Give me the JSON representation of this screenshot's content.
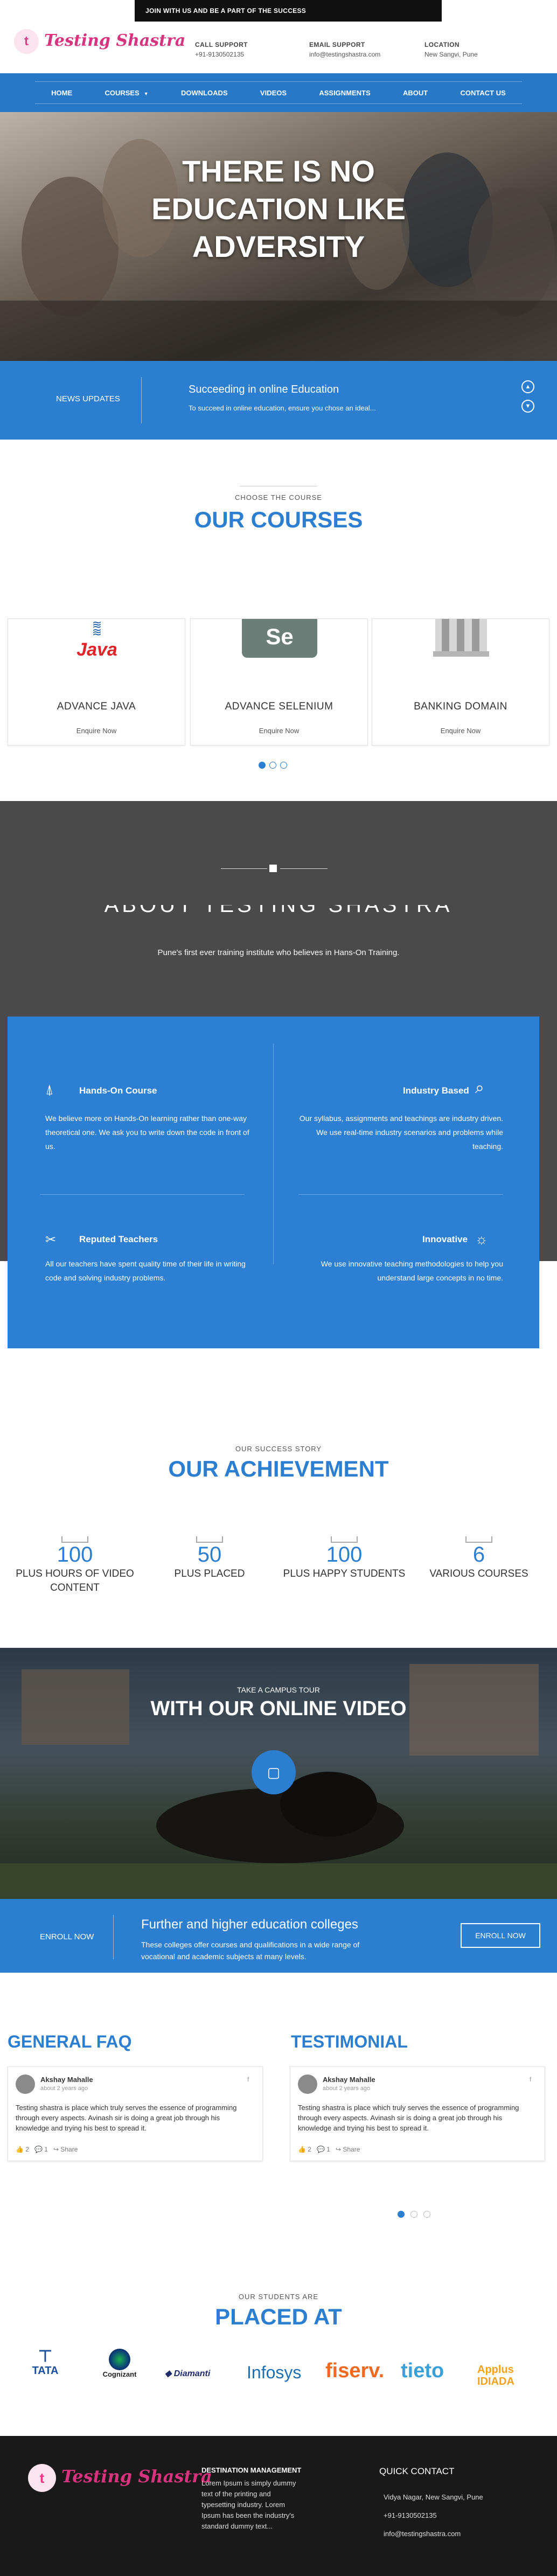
{
  "topbar": {
    "text": "JOIN WITH US AND BE A PART OF THE SUCCESS"
  },
  "header": {
    "logo_text": "Testing Shastra",
    "support": {
      "label": "CALL SUPPORT",
      "value": "+91-9130502135"
    },
    "email": {
      "label": "EMAIL SUPPORT",
      "value": "info@testingshastra.com"
    },
    "location": {
      "label": "LOCATION",
      "value": "New Sangvi, Pune"
    }
  },
  "nav": [
    "HOME",
    "COURSES",
    "DOWNLOADS",
    "VIDEOS",
    "ASSIGNMENTS",
    "ABOUT",
    "CONTACT US"
  ],
  "hero": {
    "line1": "THERE IS NO",
    "line2": "EDUCATION LIKE",
    "line3": "ADVERSITY"
  },
  "news": {
    "label": "NEWS UPDATES",
    "title": "Succeeding in online Education",
    "text": "To succeed in online education, ensure you chose an ideal..."
  },
  "courses": {
    "sub": "CHOOSE THE COURSE",
    "title": "OUR COURSES",
    "items": [
      {
        "name": "ADVANCE JAVA",
        "button": "Enquire Now",
        "logo": "Java"
      },
      {
        "name": "ADVANCE SELENIUM",
        "button": "Enquire Now",
        "logo": "Se"
      },
      {
        "name": "BANKING DOMAIN",
        "button": "Enquire Now",
        "logo": "bank-icon"
      }
    ]
  },
  "about": {
    "title": "ABOUT TESTING SHASTRA",
    "subtitle": "Pune's first ever training institute who believes in Hans-On Training.",
    "features": [
      {
        "title": "Hands-On Course",
        "text": "We believe more on Hands-On learning rather than one-way theoretical one. We ask you to write down the code in front of us."
      },
      {
        "title": "Industry Based",
        "text": "Our syllabus, assignments and teachings are industry driven. We use real-time industry scenarios and problems while teaching."
      },
      {
        "title": "Reputed Teachers",
        "text": "All our teachers have spent quality time of their life in writing code and solving industry problems."
      },
      {
        "title": "Innovative",
        "text": "We use innovative teaching methodologies to help you understand large concepts in no time."
      }
    ]
  },
  "achievement": {
    "sub": "OUR SUCCESS STORY",
    "title": "OUR ACHIEVEMENT",
    "items": [
      {
        "num": "100",
        "label": "PLUS HOURS OF VIDEO CONTENT"
      },
      {
        "num": "50",
        "label": "PLUS PLACED"
      },
      {
        "num": "100",
        "label": "PLUS HAPPY STUDENTS"
      },
      {
        "num": "6",
        "label": "VARIOUS COURSES"
      }
    ]
  },
  "video": {
    "sub": "TAKE A CAMPUS TOUR",
    "title": "WITH OUR ONLINE VIDEO"
  },
  "enroll": {
    "label": "ENROLL NOW",
    "title": "Further and higher education colleges",
    "text": "These colleges offer courses and qualifications in a wide range of vocational and academic subjects at many levels.",
    "button": "ENROLL NOW"
  },
  "faq": {
    "title": "GENERAL FAQ"
  },
  "testimonial": {
    "title": "TESTIMONIAL"
  },
  "posts": [
    {
      "name": "Akshay Mahalle",
      "time": "about 2 years ago",
      "text": "Testing shastra is place which truly serves the essence of programming through every aspects. Avinash sir is doing a great job through his knowledge and trying his best to spread it.",
      "likes": "2",
      "comments": "1",
      "share": "Share"
    },
    {
      "name": "Akshay Mahalle",
      "time": "about 2 years ago",
      "text": "Testing shastra is place which truly serves the essence of programming through every aspects. Avinash sir is doing a great job through his knowledge and trying his best to spread it.",
      "likes": "2",
      "comments": "1",
      "share": "Share"
    }
  ],
  "placed": {
    "sub": "OUR STUDENTS ARE",
    "title": "PLACED AT",
    "clients": [
      "TATA",
      "Cognizant",
      "Diamanti",
      "Infosys",
      "fiserv.",
      "tieto",
      "Applus IDIADA"
    ]
  },
  "footer": {
    "logo_text": "Testing Shastra",
    "dest_title": "DESTINATION MANAGEMENT",
    "dest_text": "Lorem Ipsum is simply dummy text of the printing and typesetting industry. Lorem Ipsum has been the industry's standard dummy text...",
    "contact_title": "QUICK CONTACT",
    "address": "Vidya Nagar, New Sangvi, Pune",
    "phone": "+91-9130502135",
    "email": "info@testingshastra.com"
  },
  "colors": {
    "accent": "#2b7ed0",
    "brand_pink": "#d8337e",
    "dark": "#191919"
  }
}
